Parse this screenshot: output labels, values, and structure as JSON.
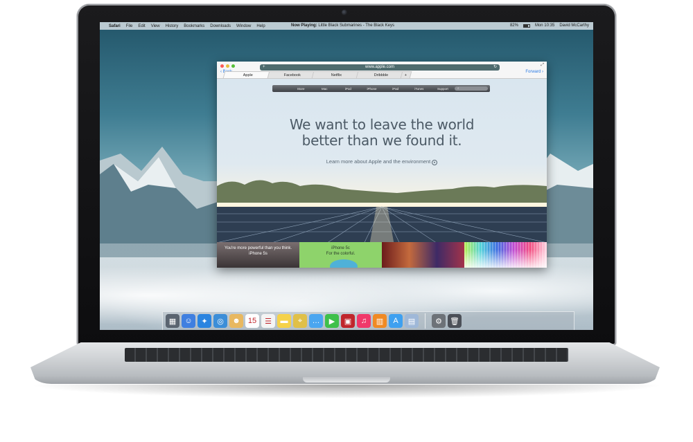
{
  "menubar": {
    "apple": "",
    "items": [
      "Safari",
      "File",
      "Edit",
      "View",
      "History",
      "Bookmarks",
      "Downloads",
      "Window",
      "Help"
    ],
    "now_playing_label": "Now Playing:",
    "now_playing_track": "Little Black Submarines - The Black Keys",
    "battery": "82%",
    "clock": "Mon 10:35",
    "user": "David McCarthy"
  },
  "browser": {
    "url": "www.apple.com",
    "back_label": "Back",
    "forward_label": "Forward",
    "tabs": [
      "Apple",
      "Facebook",
      "Netflix",
      "Dribbble",
      "+"
    ],
    "active_tab": 0
  },
  "site": {
    "nav": [
      "Store",
      "Mac",
      "iPod",
      "iPhone",
      "iPad",
      "iTunes",
      "Support"
    ],
    "hero_line1": "We want to leave the world",
    "hero_line2": "better than we found it.",
    "hero_link": "Learn more about Apple and the environment",
    "promos": [
      {
        "line1": "You're more powerful than you think.",
        "line2": "iPhone 5s"
      },
      {
        "line1": "iPhone 5c",
        "line2": "For the colorful."
      },
      {
        "line1": "",
        "line2": ""
      },
      {
        "line1": "",
        "line2": ""
      }
    ]
  },
  "dock": {
    "icons": [
      {
        "name": "launchpad",
        "color": "#5a6470",
        "glyph": "▦"
      },
      {
        "name": "finder",
        "color": "#3f7fe0",
        "glyph": "☺"
      },
      {
        "name": "safari",
        "color": "#2a84e0",
        "glyph": "✦"
      },
      {
        "name": "iphoto",
        "color": "#3c8ed8",
        "glyph": "◎"
      },
      {
        "name": "contacts",
        "color": "#e8b860",
        "glyph": "☻"
      },
      {
        "name": "calendar",
        "color": "#ffffff",
        "glyph": "15"
      },
      {
        "name": "reminders",
        "color": "#f4f4f4",
        "glyph": "☰"
      },
      {
        "name": "notes",
        "color": "#f5d24a",
        "glyph": "▬"
      },
      {
        "name": "maps",
        "color": "#e0c048",
        "glyph": "⌖"
      },
      {
        "name": "messages",
        "color": "#4aa6f0",
        "glyph": "…"
      },
      {
        "name": "facetime",
        "color": "#3ec04a",
        "glyph": "▶"
      },
      {
        "name": "photo-booth",
        "color": "#c0262c",
        "glyph": "▣"
      },
      {
        "name": "itunes",
        "color": "#f0386a",
        "glyph": "♫"
      },
      {
        "name": "ibooks",
        "color": "#f08a24",
        "glyph": "▥"
      },
      {
        "name": "app-store",
        "color": "#3ea0f0",
        "glyph": "A"
      },
      {
        "name": "preview",
        "color": "#9fb8d8",
        "glyph": "▤"
      }
    ],
    "system": [
      {
        "name": "system-preferences",
        "color": "#6d7278",
        "glyph": "⚙"
      },
      {
        "name": "trash",
        "color": "#4c5058",
        "glyph": "🗑"
      }
    ]
  }
}
